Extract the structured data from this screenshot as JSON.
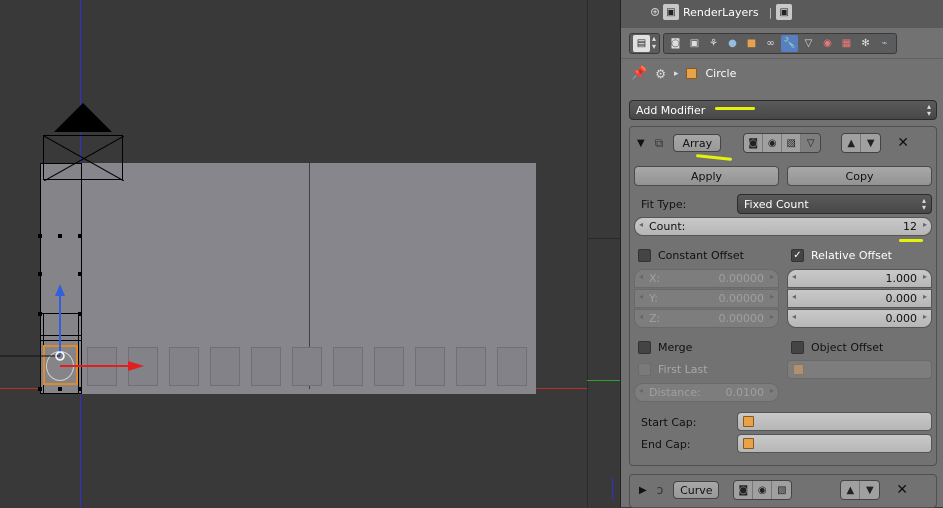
{
  "colors": {
    "accent": "#5680c2",
    "selection_orange": "#e08a2c",
    "annotation_yellow": "#e5f20a",
    "axis_x_red": "#d02020",
    "axis_y_green": "#2fa02f",
    "axis_z_blue": "#3030d0"
  },
  "outliner": {
    "render_layers_label": "RenderLayers"
  },
  "context_tabs": [
    {
      "icon": "render-icon",
      "active": false
    },
    {
      "icon": "render-layers-icon",
      "active": false
    },
    {
      "icon": "scene-icon",
      "active": false
    },
    {
      "icon": "world-icon",
      "active": false
    },
    {
      "icon": "object-icon",
      "active": false
    },
    {
      "icon": "constraints-icon",
      "active": false
    },
    {
      "icon": "modifiers-wrench-icon",
      "active": true
    },
    {
      "icon": "data-icon",
      "active": false
    },
    {
      "icon": "material-icon",
      "active": false
    },
    {
      "icon": "texture-icon",
      "active": false
    },
    {
      "icon": "particles-icon",
      "active": false
    },
    {
      "icon": "physics-icon",
      "active": false
    }
  ],
  "breadcrumb": {
    "object_name": "Circle"
  },
  "add_modifier": {
    "label": "Add Modifier"
  },
  "array_modifier": {
    "name": "Array",
    "apply_label": "Apply",
    "copy_label": "Copy",
    "fit_type_label": "Fit Type:",
    "fit_type_value": "Fixed Count",
    "count_label": "Count:",
    "count_value": "12",
    "constant_offset_label": "Constant Offset",
    "constant_offset_checked": false,
    "relative_offset_label": "Relative Offset",
    "relative_offset_checked": true,
    "constant_x_label": "X:",
    "constant_x_value": "0.00000",
    "constant_y_label": "Y:",
    "constant_y_value": "0.00000",
    "constant_z_label": "Z:",
    "constant_z_value": "0.00000",
    "relative_x_value": "1.000",
    "relative_y_value": "0.000",
    "relative_z_value": "0.000",
    "merge_label": "Merge",
    "merge_checked": false,
    "first_last_label": "First Last",
    "distance_label": "Distance:",
    "distance_value": "0.0100",
    "object_offset_label": "Object Offset",
    "object_offset_checked": false,
    "start_cap_label": "Start Cap:",
    "end_cap_label": "End Cap:"
  },
  "curve_modifier": {
    "name": "Curve"
  }
}
